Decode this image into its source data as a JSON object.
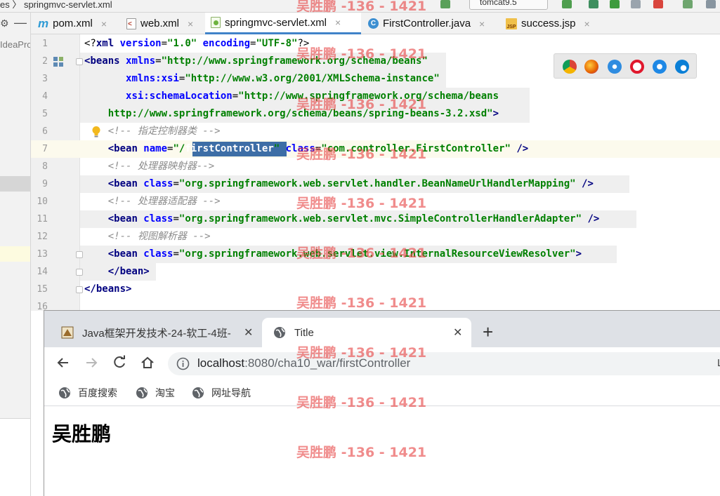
{
  "ide": {
    "breadcrumb": "es 〉 springmvc-servlet.xml",
    "run_config": "tomcat9.5",
    "project_label": "IdeaPro",
    "tabs": [
      {
        "label": "pom.xml",
        "icon": "maven-icon",
        "active": false
      },
      {
        "label": "web.xml",
        "icon": "xml-file-icon",
        "active": false
      },
      {
        "label": "springmvc-servlet.xml",
        "icon": "spring-xml-icon",
        "active": true
      },
      {
        "label": "FirstController.java",
        "icon": "java-class-icon",
        "active": false
      },
      {
        "label": "success.jsp",
        "icon": "jsp-file-icon",
        "active": false
      }
    ],
    "tab_close_glyph": "×",
    "line_numbers": [
      "1",
      "2",
      "3",
      "4",
      "5",
      "6",
      "7",
      "8",
      "9",
      "10",
      "11",
      "12",
      "13",
      "14",
      "15",
      "16"
    ],
    "code_lines": {
      "l1": {
        "decl_open": "<?",
        "decl_name": "xml",
        "a1": " version",
        "eq1": "=",
        "v1": "\"1.0\"",
        "a2": " encoding",
        "eq2": "=",
        "v2": "\"UTF-8\"",
        "decl_close": "?>"
      },
      "l2": {
        "open": "<",
        "tag": "beans",
        "attr": " xmlns",
        "eq": "=",
        "val": "\"http://www.springframework.org/schema/beans\""
      },
      "l3": {
        "indent": "       ",
        "attr": "xmlns:xsi",
        "eq": "=",
        "val": "\"http://www.w3.org/2001/XMLSchema-instance\""
      },
      "l4": {
        "indent": "       ",
        "attr": "xsi:schemaLocation",
        "eq": "=",
        "val": "\"http://www.springframework.org/schema/beans"
      },
      "l5": {
        "indent": "    ",
        "val": "http://www.springframework.org/schema/beans/spring-beans-3.2.xsd\"",
        "close": ">"
      },
      "l6": {
        "indent": "    ",
        "comment": "<!-- 指定控制器类 -->"
      },
      "l7": {
        "indent": "    ",
        "open": "<",
        "tag": "bean",
        "a1": " name",
        "eq1": "=",
        "v1a": "\"/",
        "v1sel": "firstController",
        "v1b": "\"",
        "a2": " class",
        "eq2": "=",
        "v2": "\"com.controller.FirstController\"",
        "close": " />"
      },
      "l8": {
        "indent": "    ",
        "comment": "<!-- 处理器映射器-->"
      },
      "l9": {
        "indent": "    ",
        "open": "<",
        "tag": "bean",
        "attr": " class",
        "eq": "=",
        "val": "\"org.springframework.web.servlet.handler.BeanNameUrlHandlerMapping\"",
        "close": " />"
      },
      "l10": {
        "indent": "    ",
        "comment": "<!-- 处理器适配器 -->"
      },
      "l11": {
        "indent": "    ",
        "open": "<",
        "tag": "bean",
        "attr": " class",
        "eq": "=",
        "val": "\"org.springframework.web.servlet.mvc.SimpleControllerHandlerAdapter\"",
        "close": " />"
      },
      "l12": {
        "indent": "    ",
        "comment": "<!-- 视图解析器 -->"
      },
      "l13": {
        "indent": "    ",
        "open": "<",
        "tag": "bean",
        "attr": " class",
        "eq": "=",
        "val": "\"org.springframework.web.servlet.view.InternalResourceViewResolver\"",
        "close": ">"
      },
      "l14": {
        "indent": "    ",
        "open": "</",
        "tag": "bean",
        "close": ">"
      },
      "l15": {
        "open": "</",
        "tag": "beans",
        "close": ">"
      }
    }
  },
  "browser": {
    "tabs": [
      {
        "title": "Java框架开发技术-24-软工-4班-",
        "active": false
      },
      {
        "title": "Title",
        "active": true
      }
    ],
    "close_glyph": "✕",
    "new_tab_glyph": "+",
    "url_host": "localhost",
    "url_path": ":8080/cha10_war/firstController",
    "right_edge_letter": "L",
    "bookmarks": [
      "百度搜索",
      "淘宝",
      "网址导航"
    ],
    "page_heading": "吴胜鹏"
  },
  "watermark": {
    "text": "吴胜鹏 -136 - 1421",
    "color": "#e64646"
  },
  "colors": {
    "xml_tag": "#000080",
    "xml_attr": "#0000ff",
    "xml_value": "#008000",
    "xml_comment": "#8c8c8c",
    "selection": "#3d6ea6",
    "active_tab_underline": "#4083c9"
  }
}
